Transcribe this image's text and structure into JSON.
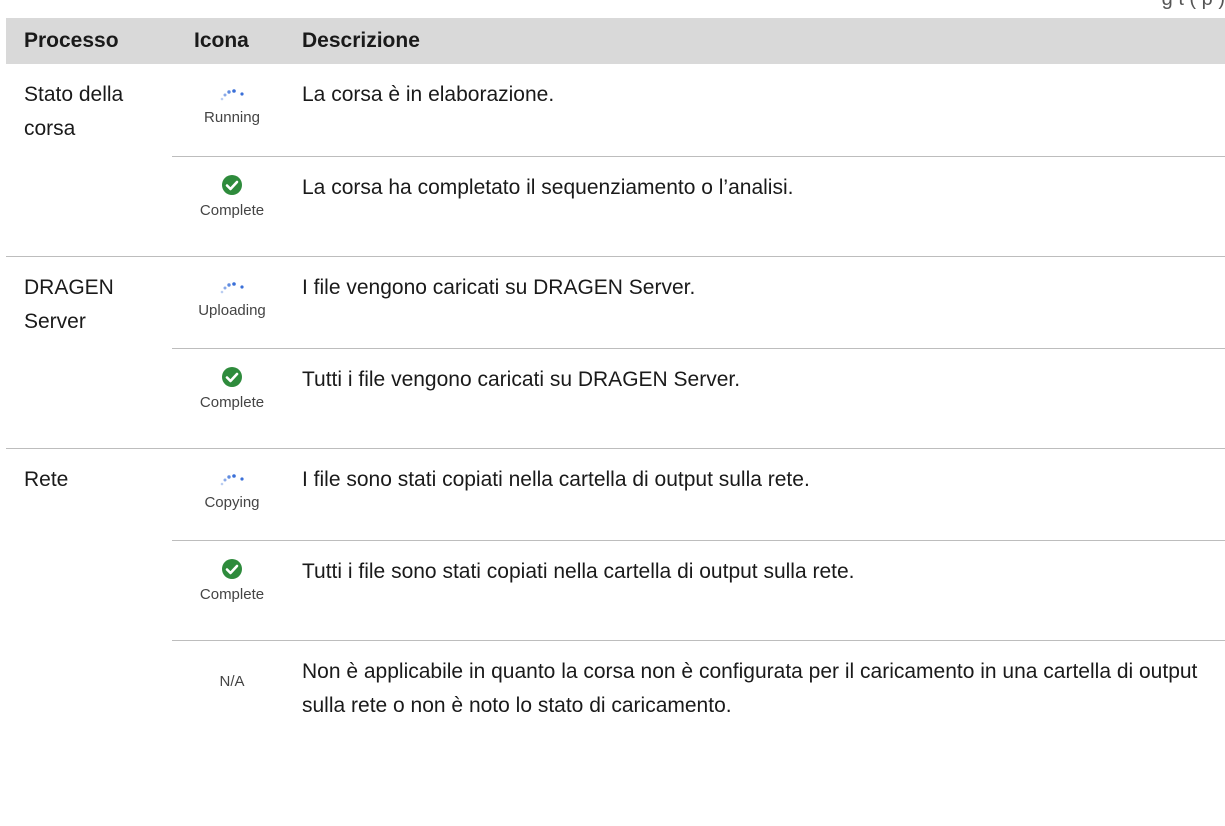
{
  "header_partial": "g t   (   p   )",
  "columns": {
    "process": "Processo",
    "icon": "Icona",
    "description": "Descrizione"
  },
  "rows": [
    {
      "process": "Stato della corsa",
      "icon": "spinner-icon",
      "status": "Running",
      "description": "La corsa è in elaborazione."
    },
    {
      "process": "",
      "icon": "check-circle-icon",
      "status": "Complete",
      "description": "La corsa ha completato il sequenziamento o l’analisi."
    },
    {
      "process": "DRAGEN Server",
      "icon": "spinner-icon",
      "status": "Uploading",
      "description": "I file vengono caricati su DRAGEN Server."
    },
    {
      "process": "",
      "icon": "check-circle-icon",
      "status": "Complete",
      "description": "Tutti i file vengono caricati su DRAGEN Server."
    },
    {
      "process": "Rete",
      "icon": "spinner-icon",
      "status": "Copying",
      "description": "I file sono stati copiati nella cartella di output sulla rete."
    },
    {
      "process": "",
      "icon": "check-circle-icon",
      "status": "Complete",
      "description": "Tutti i file sono stati copiati nella cartella di output sulla rete."
    },
    {
      "process": "",
      "icon": "none",
      "status": "N/A",
      "description": "Non è applicabile in quanto la corsa non è configurata per il caricamento in una cartella di output sulla rete o non è noto lo stato di caricamento."
    }
  ],
  "colors": {
    "header_bg": "#d9d9d9",
    "check_green": "#2e8b3c",
    "spinner_blue": "#3a6fd8",
    "divider": "#bdbdbd"
  }
}
